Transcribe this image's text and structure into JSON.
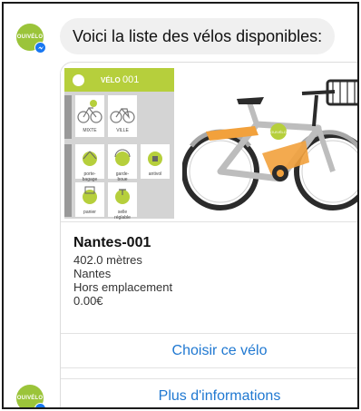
{
  "bot": {
    "avatar_text": "OUIVÉLO",
    "avatar_color": "#9bc43a",
    "badge_icon": "messenger-icon",
    "badge_color": "#1877f2"
  },
  "message": {
    "text": "Voici la liste des vélos disponibles:"
  },
  "card": {
    "image": {
      "header_prefix": "VÉLO",
      "header_number": "001",
      "header_color": "#b6cf3c",
      "labels": [
        "MIXTE",
        "VILLE",
        "porte-bagage",
        "garde-boue",
        "antivol",
        "panier",
        "selle réglable"
      ],
      "bike_wheel_text": "OUIVÉLO"
    },
    "title": "Nantes-001",
    "distance": "402.0 mètres",
    "city": "Nantes",
    "status": "Hors emplacement",
    "price": "0.00€",
    "buttons": {
      "choose": "Choisir ce vélo",
      "more_info": "Plus d'informations"
    },
    "link_color": "#1f78d1"
  }
}
